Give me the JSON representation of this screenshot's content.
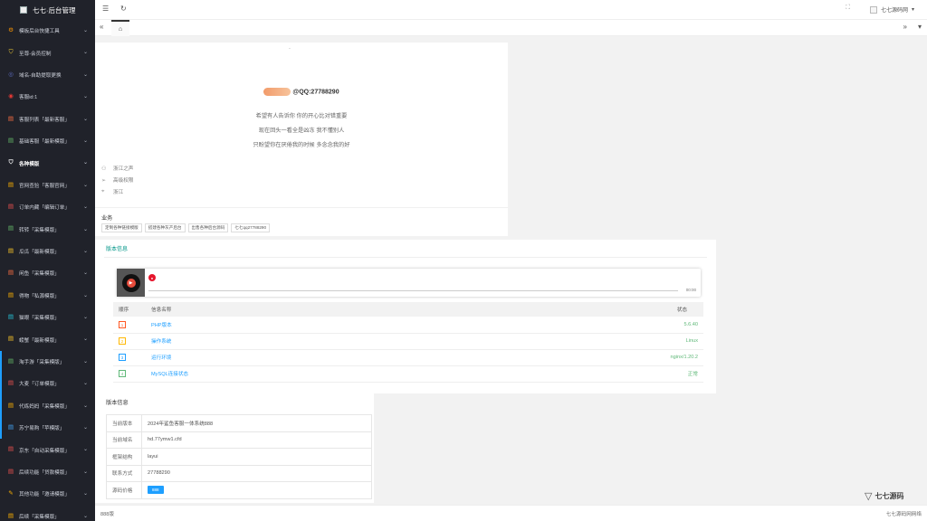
{
  "app": {
    "title": "七七·后台管理"
  },
  "sidebar": {
    "items": [
      {
        "label": "模板后台快捷工具",
        "icon": "gear-icon",
        "icon_color": "#ff9800",
        "glyph": "⚙"
      },
      {
        "label": "至尊-会员控制",
        "icon": "shield-icon",
        "icon_color": "#fdd835",
        "glyph": "⛉"
      },
      {
        "label": "域名-自助提取更换",
        "icon": "globe-icon",
        "icon_color": "#5c6bc0",
        "glyph": "◎"
      },
      {
        "label": "客服id:1",
        "icon": "headset-icon",
        "icon_color": "#e53935",
        "glyph": "◉"
      },
      {
        "label": "客服列表「最新客服」",
        "icon": "cart-icon",
        "icon_color": "#ff7043",
        "glyph": "▤"
      },
      {
        "label": "基础客服「最新模版」",
        "icon": "cart-icon",
        "icon_color": "#66bb6a",
        "glyph": "▤"
      },
      {
        "label": "各种模版",
        "icon": "shield-icon",
        "icon_color": "#ffffff",
        "glyph": "⛉"
      },
      {
        "label": "官网查验「客服官网」",
        "icon": "cart-icon",
        "icon_color": "#ffb300",
        "glyph": "▤"
      },
      {
        "label": "订单内藏「编辑订单」",
        "icon": "cart-icon",
        "icon_color": "#ef5350",
        "glyph": "▤"
      },
      {
        "label": "转转「采集模版」",
        "icon": "cart-icon",
        "icon_color": "#66bb6a",
        "glyph": "▤"
      },
      {
        "label": "瓜瓜「最新模版」",
        "icon": "cart-icon",
        "icon_color": "#ffca28",
        "glyph": "▤"
      },
      {
        "label": "闲鱼「采集模版」",
        "icon": "cart-icon",
        "icon_color": "#ff7043",
        "glyph": "▤"
      },
      {
        "label": "得物「私源模版」",
        "icon": "cart-icon",
        "icon_color": "#ffb300",
        "glyph": "▤"
      },
      {
        "label": "猫眼「采集模版」",
        "icon": "cart-icon",
        "icon_color": "#26c6da",
        "glyph": "▤"
      },
      {
        "label": "螃蟹「最新模版」",
        "icon": "cart-icon",
        "icon_color": "#ffca28",
        "glyph": "▤"
      },
      {
        "label": "淘手游「采集模版」",
        "icon": "cart-icon",
        "icon_color": "#66bb6a",
        "glyph": "▤"
      },
      {
        "label": "大麦「订单模版」",
        "icon": "cart-icon",
        "icon_color": "#ef5350",
        "glyph": "▤"
      },
      {
        "label": "代练妈妈「采集模版」",
        "icon": "cart-icon",
        "icon_color": "#ffb300",
        "glyph": "▤"
      },
      {
        "label": "苏宁易购「苹模版」",
        "icon": "cart-icon",
        "icon_color": "#42a5f5",
        "glyph": "▤"
      },
      {
        "label": "京东「自动采集模版」",
        "icon": "cart-icon",
        "icon_color": "#ef5350",
        "glyph": "▤"
      },
      {
        "label": "后续功能「贷款模版」",
        "icon": "cart-icon",
        "icon_color": "#ef5350",
        "glyph": "▤"
      },
      {
        "label": "其他功能「邀请模版」",
        "icon": "tool-icon",
        "icon_color": "#ffb300",
        "glyph": "✎"
      },
      {
        "label": "后续「采集模版」",
        "icon": "cart-icon",
        "icon_color": "#ffb300",
        "glyph": "▤"
      }
    ]
  },
  "topbar": {
    "username": "七七源码网"
  },
  "profile": {
    "small_text": "ˋ",
    "qq": "@QQ:27788290",
    "quotes": [
      "希望有人告诉你 你的开心比对错重要",
      "现在回头一看全是凶冻 我不懂别人",
      "只盼望你在厌倦我的时候 多念念我的好"
    ],
    "info": [
      {
        "icon": "user-icon",
        "text": "浙江之声"
      },
      {
        "icon": "send-icon",
        "text": "高级权限"
      },
      {
        "icon": "location-icon",
        "text": "浙江"
      }
    ],
    "business_title": "业务",
    "tags": [
      "定制各种链接模版",
      "搭建各种灰产后台",
      "出售各种后台源码",
      "七七qq27788290"
    ]
  },
  "info_panel": {
    "tab": "版本信息",
    "player_time": "00:00",
    "table": {
      "headers": [
        "顺序",
        "信息名称",
        "状态"
      ],
      "rows": [
        {
          "num": "1",
          "color": "#ff5722",
          "name": "PHP版本",
          "status": "5.6.40"
        },
        {
          "num": "2",
          "color": "#ffb800",
          "name": "操作系统",
          "status": "Linux"
        },
        {
          "num": "3",
          "color": "#1e9fff",
          "name": "运行环境",
          "status": "nginx/1.20.2"
        },
        {
          "num": "4",
          "color": "#5fb878",
          "name": "MySQL连接状态",
          "status": "正常"
        }
      ]
    }
  },
  "version_panel": {
    "title": "版本信息",
    "rows": [
      {
        "key": "当前版本",
        "value": "2024年鲨鱼客服一体系统888"
      },
      {
        "key": "当前域名",
        "value": "hd.77ymw1.cfd"
      },
      {
        "key": "框架结构",
        "value": "layui"
      },
      {
        "key": "联系方式",
        "value": "27788290"
      },
      {
        "key": "源码价格",
        "value": "888"
      }
    ]
  },
  "footer": {
    "left": "888版",
    "right": "七七源码网网络"
  },
  "watermark": {
    "brand": "七七源码"
  }
}
